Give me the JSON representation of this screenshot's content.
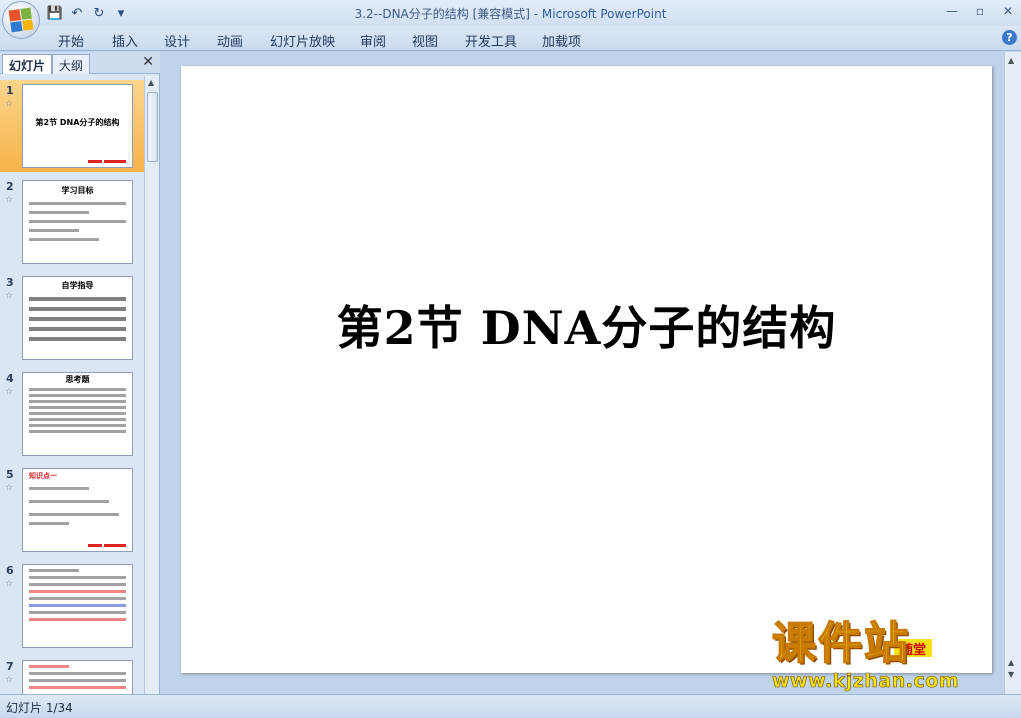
{
  "window": {
    "title_doc": "3.2--DNA分子的结构 [兼容模式] - ",
    "title_app": "Microsoft PowerPoint"
  },
  "ribbon": {
    "tabs": [
      "开始",
      "插入",
      "设计",
      "动画",
      "幻灯片放映",
      "审阅",
      "视图",
      "开发工具",
      "加载项"
    ]
  },
  "panel": {
    "tab_slides": "幻灯片",
    "tab_outline": "大纲",
    "thumbnails": [
      {
        "num": "1",
        "title": "第2节  DNA分子的结构"
      },
      {
        "num": "2",
        "title": "学习目标"
      },
      {
        "num": "3",
        "title": "自学指导"
      },
      {
        "num": "4",
        "title": "思考题"
      },
      {
        "num": "5",
        "title": "知识点一"
      },
      {
        "num": "6",
        "title": ""
      },
      {
        "num": "7",
        "title": ""
      }
    ]
  },
  "slide": {
    "title": "第2节   DNA分子的结构",
    "badge": "随堂"
  },
  "watermark": {
    "big": "课件站",
    "url": "www.kjzhan.com"
  },
  "status": {
    "slide_counter": "幻灯片 1/34"
  }
}
